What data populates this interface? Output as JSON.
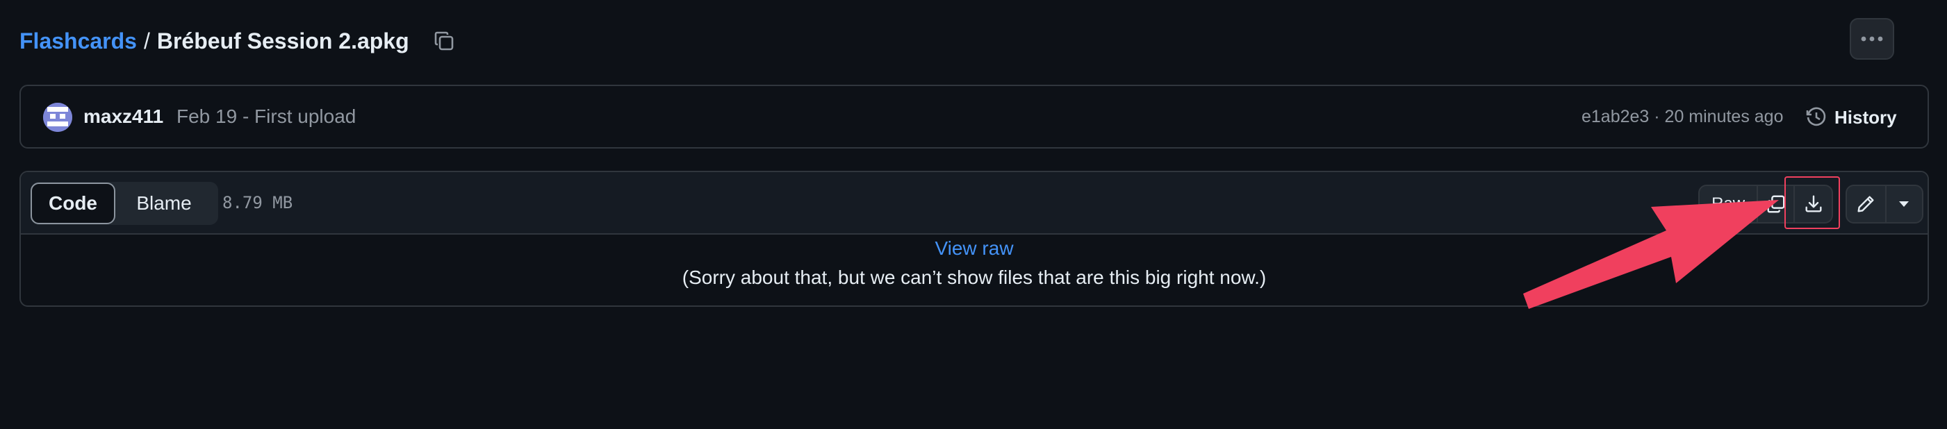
{
  "breadcrumb": {
    "repo": "Flashcards",
    "separator": "/",
    "file": "Brébeuf Session 2.apkg",
    "copy_icon": "copy-icon"
  },
  "header": {
    "more_icon": "kebab-horizontal-icon"
  },
  "commit": {
    "author": "maxz411",
    "message": "Feb 19 - First upload",
    "hash_and_time": "e1ab2e3 · 20 minutes ago",
    "history_label": "History",
    "history_icon": "history-icon"
  },
  "file": {
    "tabs": [
      "Code",
      "Blame"
    ],
    "active_tab": "Code",
    "size": "8.79 MB",
    "raw_label": "Raw",
    "view_raw_label": "View raw",
    "too_big_message": "(Sorry about that, but we can’t show files that are this big right now.)"
  },
  "annotation": {
    "highlight_color": "#f0405e",
    "target": "download-raw-button"
  },
  "colors": {
    "background": "#0d1117",
    "link": "#4493f8",
    "border": "#30363d",
    "muted": "#9198a1"
  }
}
